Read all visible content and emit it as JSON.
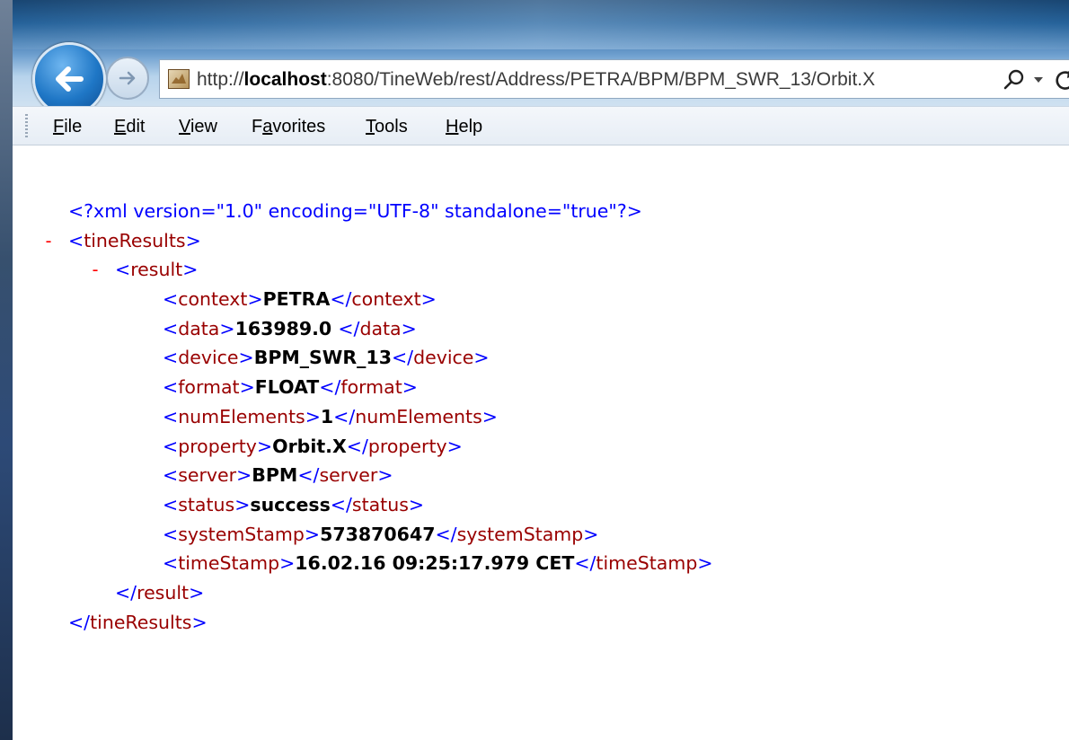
{
  "browser": {
    "url_prefix": "http://",
    "url_host": "localhost",
    "url_rest": ":8080/TineWeb/rest/Address/PETRA/BPM/BPM_SWR_13/Orbit.X",
    "search_glyph": "⌕",
    "dropdown_glyph": "▾",
    "icons": {
      "back": "back-arrow-icon",
      "forward": "forward-arrow-icon",
      "favicon": "page-favicon-icon",
      "search": "search-icon",
      "dropdown": "chevron-down-icon",
      "refresh": "refresh-icon"
    }
  },
  "menu": {
    "items": [
      {
        "mnemonic": "F",
        "rest": "ile"
      },
      {
        "mnemonic": "E",
        "rest": "dit"
      },
      {
        "mnemonic": "V",
        "rest": "iew"
      },
      {
        "pre": "F",
        "mnemonic": "a",
        "rest": "vorites"
      },
      {
        "mnemonic": "T",
        "rest": "ools"
      },
      {
        "mnemonic": "H",
        "rest": "elp"
      }
    ]
  },
  "xml": {
    "declaration": "<?xml version=\"1.0\" encoding=\"UTF-8\" standalone=\"true\"?>",
    "collapse_toggle": "-",
    "root_tag": "tineResults",
    "result_tag": "result",
    "fields": [
      {
        "tag": "context",
        "value": "PETRA"
      },
      {
        "tag": "data",
        "value": "163989.0 "
      },
      {
        "tag": "device",
        "value": "BPM_SWR_13"
      },
      {
        "tag": "format",
        "value": "FLOAT"
      },
      {
        "tag": "numElements",
        "value": "1"
      },
      {
        "tag": "property",
        "value": "Orbit.X"
      },
      {
        "tag": "server",
        "value": "BPM"
      },
      {
        "tag": "status",
        "value": "success"
      },
      {
        "tag": "systemStamp",
        "value": "573870647"
      },
      {
        "tag": "timeStamp",
        "value": "16.02.16 09:25:17.979 CET"
      }
    ]
  },
  "colors": {
    "xml_bracket": "#0000ff",
    "xml_tag": "#990000",
    "xml_toggle": "#ff0000",
    "xml_value": "#000000"
  }
}
